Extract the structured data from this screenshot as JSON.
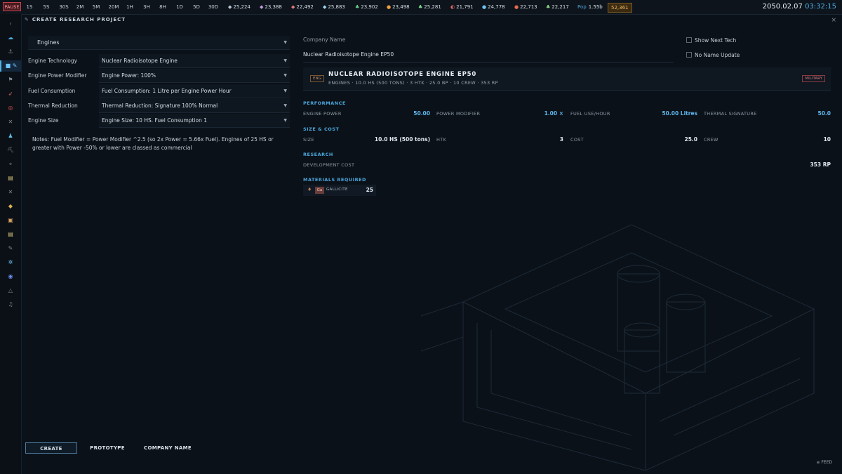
{
  "topbar": {
    "pause_label": "PAUSE",
    "speeds": [
      "1S",
      "5S",
      "30S",
      "2M",
      "5M",
      "20M",
      "1H",
      "3H",
      "8H",
      "1D",
      "5D",
      "30D"
    ],
    "resources": [
      {
        "icon": "ore-icon",
        "value": "25,224",
        "color": "#b9c7d6"
      },
      {
        "icon": "crystal-icon",
        "value": "23,388",
        "color": "#c49be0"
      },
      {
        "icon": "metal-icon",
        "value": "22,492",
        "color": "#e07a7a"
      },
      {
        "icon": "ice-icon",
        "value": "25,883",
        "color": "#9fd4f0"
      },
      {
        "icon": "leaf-icon",
        "value": "23,902",
        "color": "#6ad08a"
      },
      {
        "icon": "fire-icon",
        "value": "23,498",
        "color": "#f0a040"
      },
      {
        "icon": "sprout-icon",
        "value": "25,281",
        "color": "#7fdc8f"
      },
      {
        "icon": "gauge-icon",
        "value": "21,791",
        "color": "#e06b6b"
      },
      {
        "icon": "drop-icon",
        "value": "24,778",
        "color": "#6fc3f0"
      },
      {
        "icon": "flame-icon",
        "value": "22,713",
        "color": "#e86a50"
      },
      {
        "icon": "plant-icon",
        "value": "22,217",
        "color": "#8fd88a"
      }
    ],
    "pop_label": "Pop",
    "pop_value": "1.55b",
    "wealth": "52,361",
    "date": "2050.02.07",
    "time": "03:32:15"
  },
  "window": {
    "title": "CREATE RESEARCH PROJECT"
  },
  "form": {
    "category": "Engines",
    "rows": [
      {
        "label": "Engine Technology",
        "value": "Nuclear Radioisotope Engine"
      },
      {
        "label": "Engine Power Modifier",
        "value": "Engine Power: 100%"
      },
      {
        "label": "Fuel Consumption",
        "value": "Fuel Consumption: 1 Litre per Engine Power Hour"
      },
      {
        "label": "Thermal Reduction",
        "value": "Thermal Reduction: Signature 100% Normal"
      },
      {
        "label": "Engine Size",
        "value": "Engine Size: 10 HS. Fuel Consumption 1"
      }
    ],
    "notes": "Notes: Fuel Modifier = Power Modifier ^2.5  (so 2x Power = 5.66x Fuel). Engines of 25 HS or greater with Power -50% or lower are classed as commercial"
  },
  "buttons": {
    "create": "CREATE",
    "prototype": "PROTOTYPE",
    "company_name": "COMPANY NAME"
  },
  "feed": "FEED",
  "right": {
    "company_label": "Company Name",
    "company_value": "Nuclear Radioisotope Engine  EP50",
    "show_next_tech": "Show Next Tech",
    "no_name_update": "No Name Update",
    "card": {
      "tag": "ENG",
      "name": "NUCLEAR RADIOISOTOPE ENGINE EP50",
      "desc": "ENGINES · 10.0 HS (500 TONS) · 3 HTK · 25.0 BP · 10 CREW · 353 RP",
      "badge": "MILITARY"
    },
    "performance": {
      "title": "PERFORMANCE",
      "engine_power_label": "ENGINE POWER",
      "engine_power": "50.00",
      "power_modifier_label": "POWER MODIFIER",
      "power_modifier": "1.00 ×",
      "fuel_use_label": "FUEL USE/HOUR",
      "fuel_use": "50.00 Litres",
      "thermal_label": "THERMAL SIGNATURE",
      "thermal": "50.0"
    },
    "size_cost": {
      "title": "SIZE & COST",
      "size_label": "SIZE",
      "size": "10.0 HS (500 tons)",
      "htk_label": "HTK",
      "htk": "3",
      "cost_label": "COST",
      "cost": "25.0",
      "crew_label": "CREW",
      "crew": "10"
    },
    "research": {
      "title": "RESEARCH",
      "dev_cost_label": "DEVELOPMENT COST",
      "dev_cost": "353 RP"
    },
    "materials": {
      "title": "MATERIALS REQUIRED",
      "badge": "Ga",
      "name": "GALLICITE",
      "value": "25"
    }
  }
}
